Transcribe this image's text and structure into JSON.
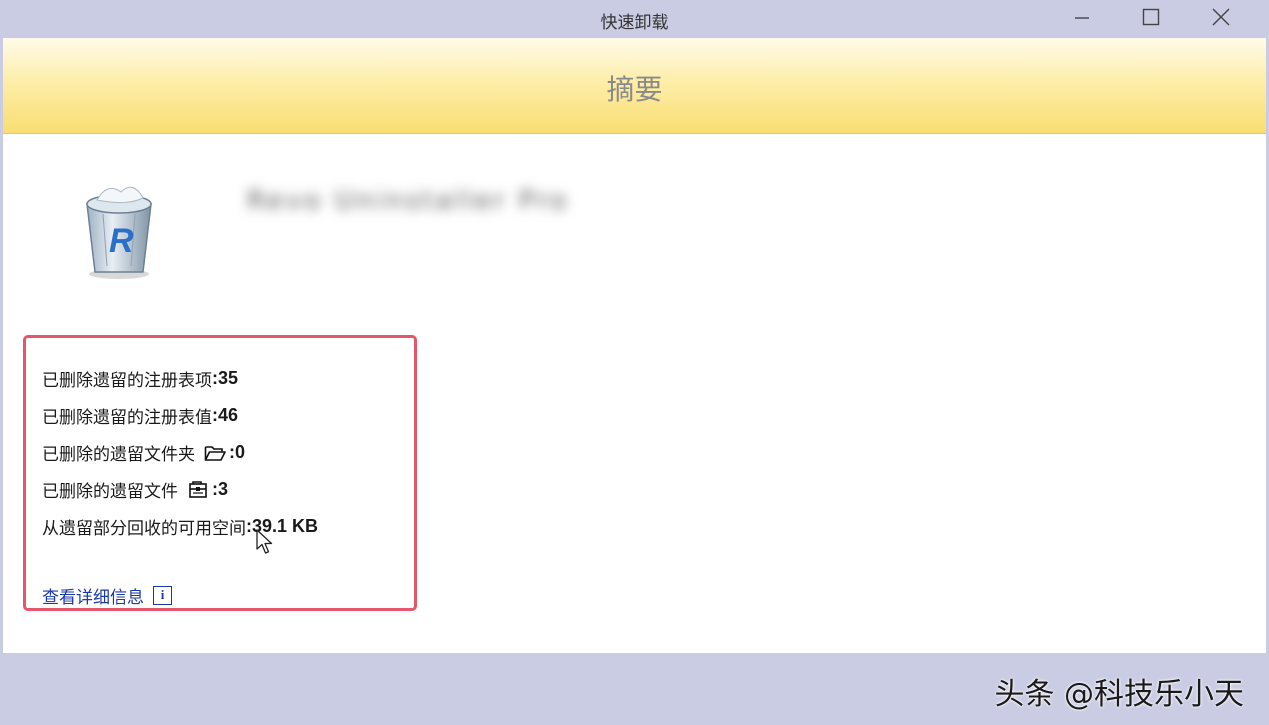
{
  "window": {
    "title": "快速卸载",
    "controls": {
      "minimize": "minimize-icon",
      "maximize": "maximize-icon",
      "close": "close-icon"
    }
  },
  "banner": {
    "title": "摘要"
  },
  "app": {
    "icon": "recycle-bin-icon",
    "name_blurred": "Revo Uninstaller Pro"
  },
  "summary": {
    "items": [
      {
        "label": "已删除遗留的注册表项",
        "value": "35"
      },
      {
        "label": "已删除遗留的注册表值",
        "value": "46"
      },
      {
        "label": "已删除的遗留文件夹",
        "icon": "folder-open-icon",
        "value": "0"
      },
      {
        "label": "已删除的遗留文件",
        "icon": "file-icon",
        "value": "3"
      },
      {
        "label": "从遗留部分回收的可用空间",
        "value": "39.1 KB"
      }
    ],
    "details_link": "查看详细信息",
    "separator": ": "
  },
  "footer": {
    "watermark": "头条 @科技乐小天"
  },
  "colors": {
    "accent_border": "#e5556b",
    "link": "#1a3aa6",
    "chrome": "#c9cce3",
    "banner": "#f9de72"
  }
}
